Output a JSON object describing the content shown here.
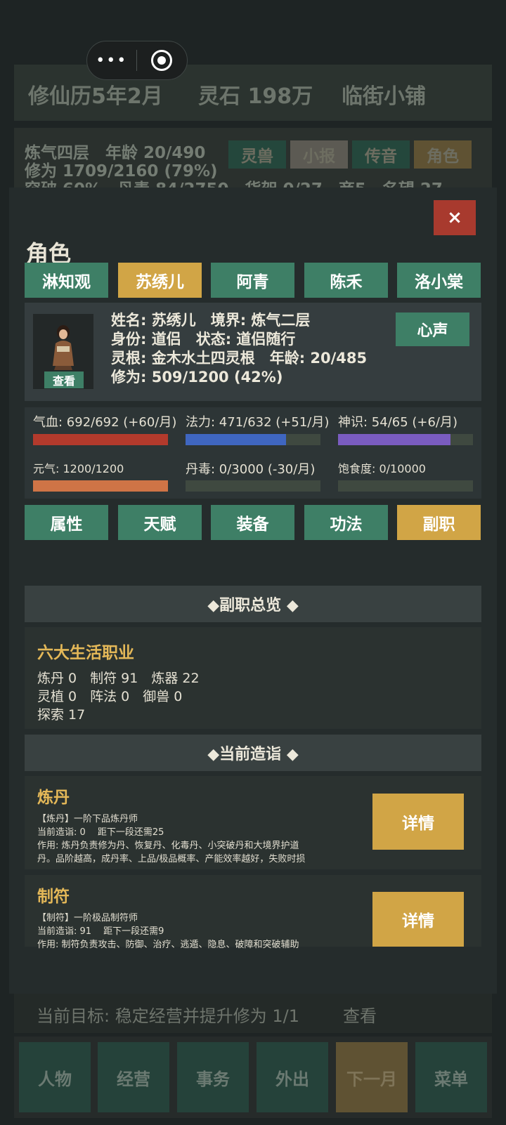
{
  "header": {
    "date": "修仙历5年2月",
    "spirit_stones": "灵石 198万",
    "shop": "临街小铺"
  },
  "bg_info": {
    "line1": "炼气四层　年龄 20/490",
    "line2": "修为 1709/2160 (79%)",
    "line3": "突破 60%　丹毒 84/2750　货架 0/27　商5　名望 27"
  },
  "bg_buttons": [
    "灵兽",
    "小报",
    "传音",
    "角色"
  ],
  "capsule": {
    "dots": "•••"
  },
  "modal": {
    "close": "×",
    "title": "角色",
    "tabs": [
      "淋知观",
      "苏绣儿",
      "阿青",
      "陈禾",
      "洛小棠"
    ],
    "active_tab": 1
  },
  "profile": {
    "line1": "姓名: 苏绣儿　境界: 炼气二层",
    "line2": "身份: 道侣　状态: 道侣随行",
    "line3": "灵根: 金木水土四灵根　年龄: 20/485",
    "line4": "修为: 509/1200 (42%)",
    "view": "查看",
    "heart": "心声"
  },
  "stats": [
    {
      "label": "气血: 692/692 (+60/月)",
      "value": 692,
      "max": 692,
      "color": "#b33a2c"
    },
    {
      "label": "法力: 471/632 (+51/月)",
      "value": 471,
      "max": 632,
      "color": "#3f66c0"
    },
    {
      "label": "神识: 54/65 (+6/月)",
      "value": 54,
      "max": 65,
      "color": "#7a5cc0"
    },
    {
      "label": "元气: 1200/1200",
      "value": 1200,
      "max": 1200,
      "color": "#cf7446"
    },
    {
      "label": "丹毒: 0/3000 (-30/月)",
      "value": 0,
      "max": 3000,
      "color": "#3f4940"
    },
    {
      "label": "饱食度: 0/10000",
      "value": 0,
      "max": 10000,
      "color": "#3f4940"
    }
  ],
  "sub_tabs": [
    "属性",
    "天赋",
    "装备",
    "功法",
    "副职"
  ],
  "overview": {
    "heading": "◆副职总览 ◆",
    "title": "六大生活职业",
    "line1": "炼丹 0　制符 91　炼器 22",
    "line2": "灵植 0　阵法 0　御兽 0",
    "line3": "探索 17"
  },
  "current": {
    "heading": "◆当前造诣 ◆",
    "cards": [
      {
        "title": "炼丹",
        "rank": "【炼丹】一阶下品炼丹师",
        "progress": "当前造诣: 0　 距下一段还需25",
        "desc1": "作用: 炼丹负责修为丹、恢复丹、化毒丹、小突破丹和大境界护道",
        "desc2": "丹。品阶越高，成丹率、上品/极品概率、产能效率越好，失败时损",
        "button": "详情"
      },
      {
        "title": "制符",
        "rank": "【制符】一阶极品制符师",
        "progress": "当前造诣: 91　 距下一段还需9",
        "desc1": "作用: 制符负责攻击、防御、治疗、逃遁、隐息、破障和突破辅助",
        "desc2": "",
        "button": "详情"
      }
    ]
  },
  "goal": {
    "text": "当前目标: 稳定经营并提升修为 1/1",
    "view": "查看"
  },
  "bottom_nav": [
    "人物",
    "经营",
    "事务",
    "外出",
    "下一月",
    "菜单"
  ]
}
